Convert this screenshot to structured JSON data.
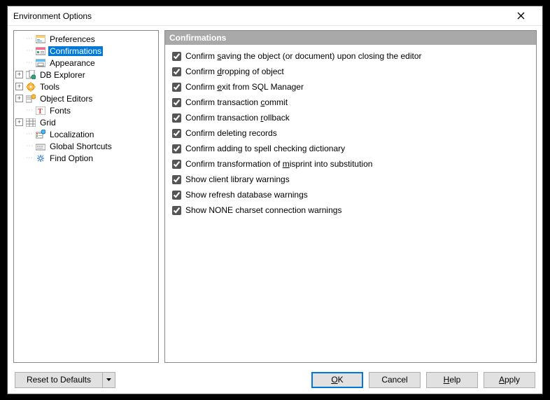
{
  "window": {
    "title": "Environment Options"
  },
  "tree": {
    "items": [
      {
        "label": "Preferences",
        "expandable": false,
        "selected": false,
        "iconType": "pref"
      },
      {
        "label": "Confirmations",
        "expandable": false,
        "selected": true,
        "iconType": "conf"
      },
      {
        "label": "Appearance",
        "expandable": false,
        "selected": false,
        "iconType": "appear"
      },
      {
        "label": "DB Explorer",
        "expandable": true,
        "selected": false,
        "iconType": "db"
      },
      {
        "label": "Tools",
        "expandable": true,
        "selected": false,
        "iconType": "tools"
      },
      {
        "label": "Object Editors",
        "expandable": true,
        "selected": false,
        "iconType": "obj"
      },
      {
        "label": "Fonts",
        "expandable": false,
        "selected": false,
        "iconType": "fonts"
      },
      {
        "label": "Grid",
        "expandable": true,
        "selected": false,
        "iconType": "grid"
      },
      {
        "label": "Localization",
        "expandable": false,
        "selected": false,
        "iconType": "loc"
      },
      {
        "label": "Global Shortcuts",
        "expandable": false,
        "selected": false,
        "iconType": "short"
      },
      {
        "label": "Find Option",
        "expandable": false,
        "selected": false,
        "iconType": "find"
      }
    ]
  },
  "section": {
    "header": "Confirmations",
    "checks": [
      {
        "checked": true,
        "before": "Confirm ",
        "u": "s",
        "after": "aving the object (or document) upon closing the editor"
      },
      {
        "checked": true,
        "before": "Confirm ",
        "u": "d",
        "after": "ropping of object"
      },
      {
        "checked": true,
        "before": "Confirm ",
        "u": "e",
        "after": "xit from SQL Manager"
      },
      {
        "checked": true,
        "before": "Confirm transaction ",
        "u": "c",
        "after": "ommit"
      },
      {
        "checked": true,
        "before": "Confirm transaction ",
        "u": "r",
        "after": "ollback"
      },
      {
        "checked": true,
        "before": "Confirm deleting records",
        "u": "",
        "after": ""
      },
      {
        "checked": true,
        "before": "Confirm addin",
        "u": "g",
        "after": " to spell checking dictionary"
      },
      {
        "checked": true,
        "before": "Confirm transformation of ",
        "u": "m",
        "after": "isprint into substitution"
      },
      {
        "checked": true,
        "before": "Show client library warnings",
        "u": "",
        "after": ""
      },
      {
        "checked": true,
        "before": "Show refresh database warnings",
        "u": "",
        "after": ""
      },
      {
        "checked": true,
        "before": "Show NONE charset connection warnings",
        "u": "",
        "after": ""
      }
    ]
  },
  "buttons": {
    "reset": "Reset to Defaults",
    "ok_u": "O",
    "ok_rest": "K",
    "cancel": "Cancel",
    "help_u": "H",
    "help_rest": "elp",
    "apply_u": "A",
    "apply_rest": "pply"
  }
}
